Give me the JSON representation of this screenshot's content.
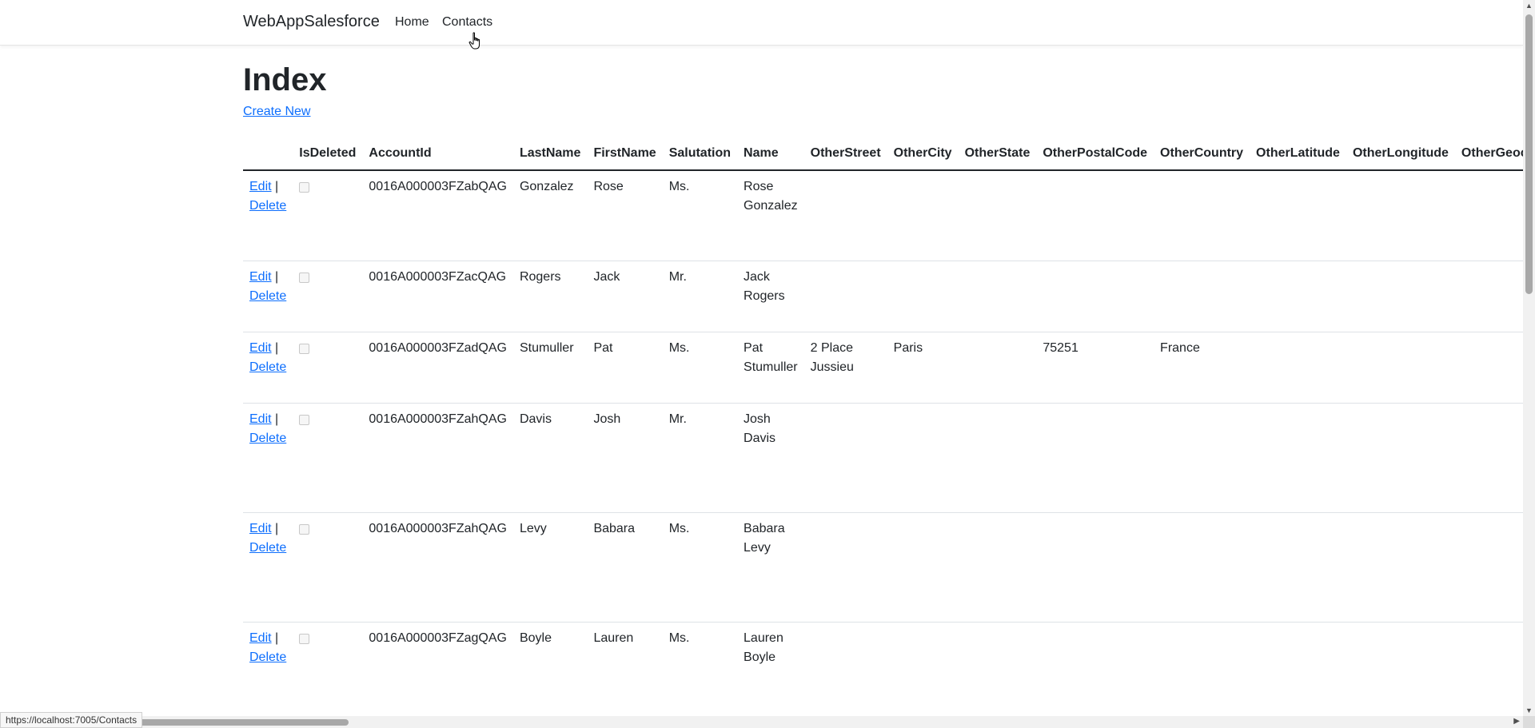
{
  "navbar": {
    "brand": "WebAppSalesforce",
    "links": [
      {
        "label": "Home"
      },
      {
        "label": "Contacts"
      }
    ]
  },
  "page": {
    "title": "Index",
    "create_label": "Create New"
  },
  "table": {
    "headers": [
      "",
      "IsDeleted",
      "AccountId",
      "LastName",
      "FirstName",
      "Salutation",
      "Name",
      "OtherStreet",
      "OtherCity",
      "OtherState",
      "OtherPostalCode",
      "OtherCountry",
      "OtherLatitude",
      "OtherLongitude",
      "OtherGeocodeAccuracy"
    ],
    "edit_label": "Edit",
    "separator": "|",
    "delete_label": "Delete",
    "rows": [
      {
        "account_id": "0016A000003FZabQAG",
        "last": "Gonzalez",
        "first": "Rose",
        "salutation": "Ms.",
        "name_line1": "Rose",
        "name_line2": "Gonzalez",
        "street_line1": "",
        "street_line2": "",
        "city": "",
        "state": "",
        "postal": "",
        "country": ""
      },
      {
        "account_id": "0016A000003FZacQAG",
        "last": "Rogers",
        "first": "Jack",
        "salutation": "Mr.",
        "name_line1": "Jack",
        "name_line2": "Rogers",
        "street_line1": "",
        "street_line2": "",
        "city": "",
        "state": "",
        "postal": "",
        "country": ""
      },
      {
        "account_id": "0016A000003FZadQAG",
        "last": "Stumuller",
        "first": "Pat",
        "salutation": "Ms.",
        "name_line1": "Pat",
        "name_line2": "Stumuller",
        "street_line1": "2 Place",
        "street_line2": "Jussieu",
        "city": "Paris",
        "state": "",
        "postal": "75251",
        "country": "France"
      },
      {
        "account_id": "0016A000003FZahQAG",
        "last": "Davis",
        "first": "Josh",
        "salutation": "Mr.",
        "name_line1": "Josh",
        "name_line2": "Davis",
        "street_line1": "",
        "street_line2": "",
        "city": "",
        "state": "",
        "postal": "",
        "country": ""
      },
      {
        "account_id": "0016A000003FZahQAG",
        "last": "Levy",
        "first": "Babara",
        "salutation": "Ms.",
        "name_line1": "Babara",
        "name_line2": "Levy",
        "street_line1": "",
        "street_line2": "",
        "city": "",
        "state": "",
        "postal": "",
        "country": ""
      },
      {
        "account_id": "0016A000003FZagQAG",
        "last": "Boyle",
        "first": "Lauren",
        "salutation": "Ms.",
        "name_line1": "Lauren",
        "name_line2": "Boyle",
        "street_line1": "",
        "street_line2": "",
        "city": "",
        "state": "",
        "postal": "",
        "country": ""
      }
    ]
  },
  "statusbar": {
    "url": "https://localhost:7005/Contacts"
  }
}
